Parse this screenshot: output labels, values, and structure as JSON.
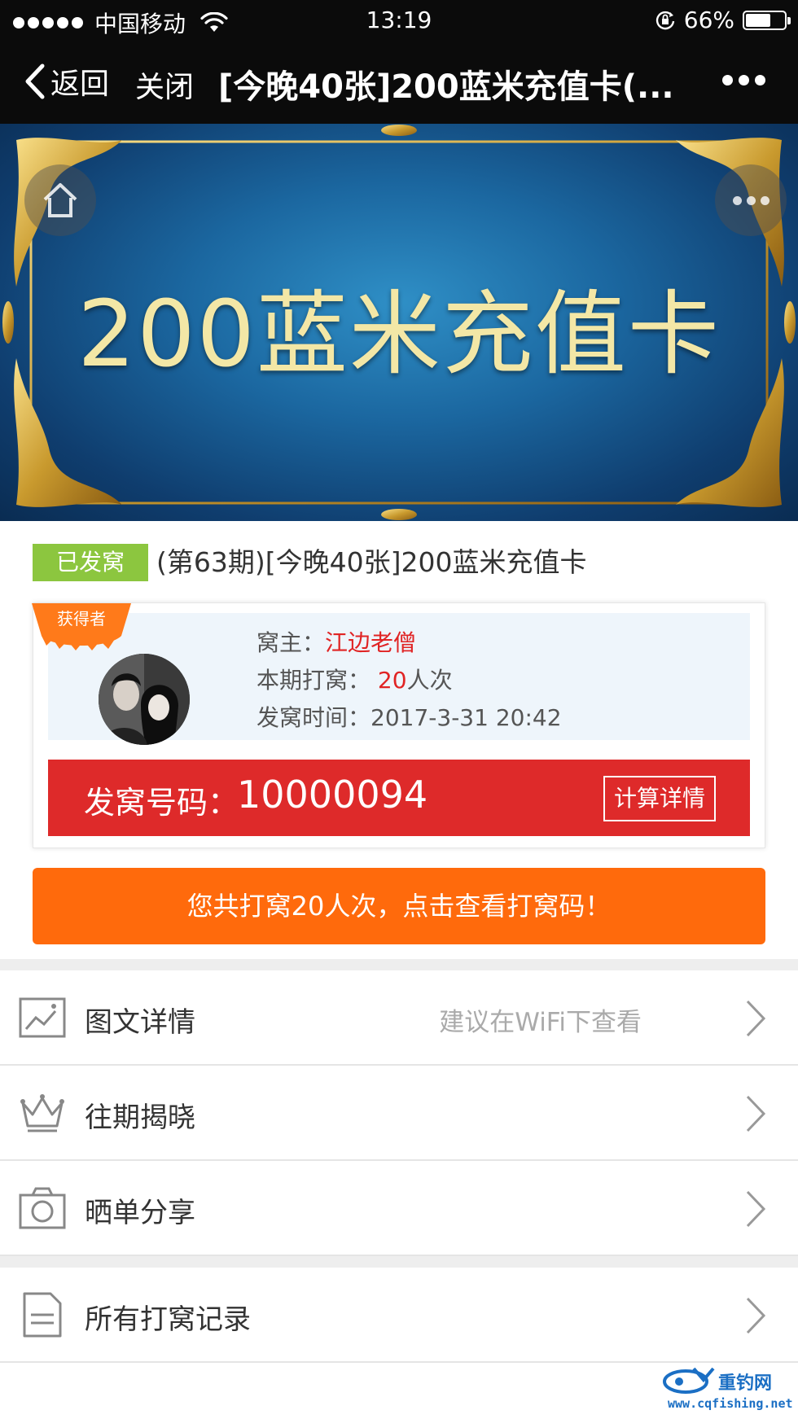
{
  "status_bar": {
    "carrier": "中国移动",
    "time": "13:19",
    "battery_percent": "66%",
    "battery_level": 0.66
  },
  "nav": {
    "back_label": "返回",
    "close_label": "关闭",
    "title": "[今晚40张]200蓝米充值卡(...",
    "more_icon": "more-dots-icon"
  },
  "banner": {
    "title": "200蓝米充值卡",
    "home_icon": "home-icon",
    "more_icon": "more-dots-icon"
  },
  "product": {
    "badge": "已发窝",
    "title": "(第63期)[今晚40张]200蓝米充值卡"
  },
  "winner": {
    "ribbon_label": "获得者",
    "owner_label": "窝主：",
    "owner_name": "江边老僧",
    "count_label": "本期打窝：",
    "count_value": "20",
    "count_unit": "人次",
    "time_label": "发窝时间：",
    "time_value": "2017-3-31 20:42",
    "code_label": "发窝号码：",
    "code_value": "10000094",
    "calc_button": "计算详情"
  },
  "actions": {
    "view_codes": "您共打窝20人次，点击查看打窝码！"
  },
  "menu": [
    {
      "icon": "image-icon",
      "label": "图文详情",
      "hint": "建议在WiFi下查看"
    },
    {
      "icon": "crown-icon",
      "label": "往期揭晓",
      "hint": ""
    },
    {
      "icon": "camera-icon",
      "label": "晒单分享",
      "hint": ""
    },
    {
      "icon": "document-icon",
      "label": "所有打窝记录",
      "hint": ""
    }
  ],
  "watermark": {
    "brand": "重钓网",
    "url": "www.cqfishing.net"
  },
  "colors": {
    "accent_red": "#de2a2a",
    "accent_orange": "#ff6a0c",
    "badge_green": "#8cc63f",
    "banner_blue": "#1b67a0",
    "banner_text": "#f3e7a6"
  }
}
